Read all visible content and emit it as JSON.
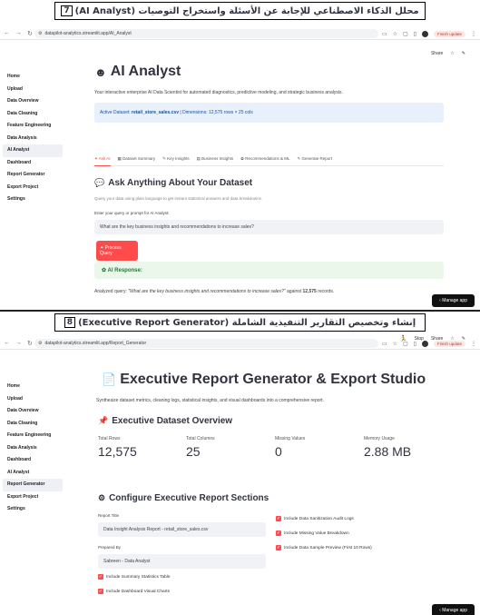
{
  "panel1": {
    "caption_text": "محلل الذكاء الاصطناعي للإجابة عن الأسئلة واستخراج التوصيات (AI Analyst)",
    "caption_num": "7",
    "browser": {
      "url": "datapilot-analytics.streamlit.app/AI_Analyst",
      "finish_update": "Finish update"
    },
    "sidebar": [
      "Home",
      "Upload",
      "Data Overview",
      "Data Cleaning",
      "Feature Engineering",
      "Data Analysis",
      "AI Analyst",
      "Dashboard",
      "Report Generator",
      "Export Project",
      "Settings"
    ],
    "active_item": "AI Analyst",
    "topbar": {
      "share": "Share"
    },
    "title": "AI Analyst",
    "subtitle": "Your interactive enterprise AI Data Scientist for automated diagnostics, predictive modeling, and strategic business analysis.",
    "info_prefix": "Active Dataset: ",
    "info_file": "retail_store_sales.csv",
    "info_suffix": " | Dimensions: 12,575 rows × 25 cols",
    "tabs": [
      "Ask AI",
      "Dataset Summary",
      "Key Insights",
      "Business Insights",
      "Recommendations & ML",
      "Generate Report"
    ],
    "section_title": "Ask Anything About Your Dataset",
    "section_hint": "Query your data using plain language to get instant statistical answers and data breakdowns.",
    "input_label": "Enter your query or prompt for AI Analyst:",
    "input_value": "What are the key business insights and recommendations to increase sales?",
    "process_button": "✦ Process Query",
    "ai_response": "AI Response:",
    "analyzed_prefix": "Analyzed query: ",
    "analyzed_query": "\"What are the key business insights and recommendations to increase sales?\"",
    "analyzed_suffix": " against ",
    "analyzed_records": "12,575",
    "analyzed_end": " records.",
    "manage_app": "Manage app"
  },
  "panel2": {
    "caption_text": "إنشاء وتخصيص التقارير التنفيذية الشاملة (Executive Report Generator)",
    "caption_num": "8",
    "browser": {
      "url": "datapilot-analytics.streamlit.app/Report_Generator",
      "finish_update": "Finish update"
    },
    "sidebar": [
      "Home",
      "Upload",
      "Data Overview",
      "Data Cleaning",
      "Feature Engineering",
      "Data Analysis",
      "Dashboard",
      "AI Analyst",
      "Report Generator",
      "Export Project",
      "Settings"
    ],
    "active_item": "Report Generator",
    "topbar": {
      "stop": "Stop",
      "share": "Share"
    },
    "title": "Executive Report Generator & Export Studio",
    "subtitle": "Synthesize dataset metrics, cleaning logs, statistical insights, and visual dashboards into a comprehensive report.",
    "overview_title": "Executive Dataset Overview",
    "metrics": [
      {
        "label": "Total Rows",
        "value": "12,575"
      },
      {
        "label": "Total Columns",
        "value": "25"
      },
      {
        "label": "Missing Values",
        "value": "0"
      },
      {
        "label": "Memory Usage",
        "value": "2.88 MB"
      }
    ],
    "configure_title": "Configure Executive Report Sections",
    "report_title_label": "Report Title",
    "report_title_value": "Data Insight Analysis Report - retail_store_sales.csv",
    "prepared_by_label": "Prepared By",
    "prepared_by_value": "Sabreen - Data Analyst",
    "left_checks": [
      "Include Summary Statistics Table",
      "Include Dashboard Visual Charts"
    ],
    "right_checks": [
      "Include Data Sanitization Audit Logs",
      "Include Missing Value Breakdown",
      "Include Data Sample Preview (First 10 Rows)"
    ],
    "manage_app": "Manage app"
  }
}
